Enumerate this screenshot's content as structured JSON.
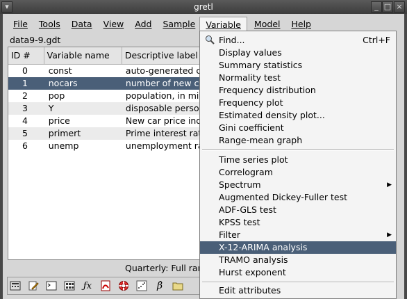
{
  "window": {
    "title": "gretl"
  },
  "menubar": [
    "File",
    "Tools",
    "Data",
    "View",
    "Add",
    "Sample",
    "Variable",
    "Model",
    "Help"
  ],
  "dataset": {
    "filename": "data9-9.gdt"
  },
  "table": {
    "headers": [
      "ID #",
      "Variable name",
      "Descriptive label"
    ],
    "rows": [
      {
        "id": "0",
        "name": "const",
        "label": "auto-generated c"
      },
      {
        "id": "1",
        "name": "nocars",
        "label": "number of new ca"
      },
      {
        "id": "2",
        "name": "pop",
        "label": "population, in mill"
      },
      {
        "id": "3",
        "name": "Y",
        "label": "disposable perso"
      },
      {
        "id": "4",
        "name": "price",
        "label": "New car price ind"
      },
      {
        "id": "5",
        "name": "primert",
        "label": "Prime interest rat"
      },
      {
        "id": "6",
        "name": "unemp",
        "label": "unemployment ra"
      }
    ],
    "selected_row": 1
  },
  "status": "Quarterly: Full ran",
  "menu": {
    "find": {
      "label": "Find...",
      "accel": "Ctrl+F"
    },
    "items": [
      "Display values",
      "Summary statistics",
      "Normality test",
      "Frequency distribution",
      "Frequency plot",
      "Estimated density plot...",
      "Gini coefficient",
      "Range-mean graph",
      "Time series plot",
      "Correlogram",
      "Spectrum",
      "Augmented Dickey-Fuller test",
      "ADF-GLS test",
      "KPSS test",
      "Filter",
      "X-12-ARIMA analysis",
      "TRAMO analysis",
      "Hurst exponent",
      "Edit attributes"
    ],
    "highlighted": "X-12-ARIMA analysis"
  },
  "colors": {
    "selection": "#4a5f78",
    "titlebar": "#474747",
    "menu_bg": "#f4f4f4"
  },
  "toolbar_icons": [
    "calculator-icon",
    "edit-icon",
    "terminal-icon",
    "grid-icon",
    "fx-icon",
    "pdf-icon",
    "lifebuoy-icon",
    "scatter-plot-icon",
    "beta-icon",
    "folder-icon"
  ]
}
